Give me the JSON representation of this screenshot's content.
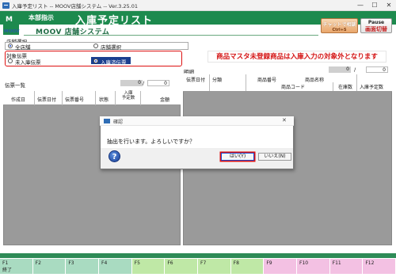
{
  "window": {
    "title": "入庫予定リスト -- MOOV店舗システム -- Ver.3.25.01",
    "minimize": "—",
    "maximize": "☐",
    "close": "✕"
  },
  "header": {
    "logo_letter": "M",
    "logo_text": "MOOV",
    "label": "本部指示",
    "title": "入庫予定リスト",
    "subtitle": "MOOV 店舗システム",
    "chat_button": {
      "line1": "チャットで相談",
      "line2": "Ctrl+S"
    },
    "pause_button": {
      "line1": "Pause",
      "line2": "画面切替"
    },
    "colors": {
      "brand_green": "#1d8a4e",
      "accent_red": "#d41414"
    }
  },
  "store_selection": {
    "label": "店舗選択",
    "options": [
      {
        "label": "全店舗",
        "selected": true
      },
      {
        "label": "店舗選択",
        "selected": false
      }
    ]
  },
  "slip_target": {
    "label": "対象伝票",
    "options": [
      {
        "label": "未入庫伝票",
        "selected": false
      },
      {
        "label": "入庫済伝票",
        "selected": true
      }
    ]
  },
  "warning": "商品マスタ未登録商品は入庫入力の対象外となります",
  "detail": {
    "label": "明細",
    "count": "0",
    "slash": "/",
    "total": "0",
    "columns": [
      "伝票日付",
      "分類",
      "商品番号",
      "商品名称",
      "商品コード",
      "在庫数",
      "入庫予定数"
    ]
  },
  "slip_list": {
    "label": "伝票一覧",
    "count": "0",
    "slash": "/",
    "total": "0",
    "columns": [
      "作成日",
      "伝票日付",
      "伝票番号",
      "状態",
      "入庫\n予定数",
      "金額"
    ],
    "col_planned_line1": "入庫",
    "col_planned_line2": "予定数"
  },
  "dialog": {
    "title": "確認",
    "message": "抽出を行います。よろしいですか？",
    "icon": "question-icon",
    "icon_glyph": "?",
    "yes_button": "はい(Y)",
    "no_button": "いいえ(N)"
  },
  "function_keys": [
    {
      "key": "F1",
      "label": "終了",
      "color": "#a9dbc1"
    },
    {
      "key": "F2",
      "label": "",
      "color": "#a9dbc1"
    },
    {
      "key": "F3",
      "label": "",
      "color": "#a9dbc1"
    },
    {
      "key": "F4",
      "label": "",
      "color": "#a9dbc1"
    },
    {
      "key": "F5",
      "label": "",
      "color": "#bfe8a6"
    },
    {
      "key": "F6",
      "label": "",
      "color": "#bfe8a6"
    },
    {
      "key": "F7",
      "label": "",
      "color": "#bfe8a6"
    },
    {
      "key": "F8",
      "label": "",
      "color": "#bfe8a6"
    },
    {
      "key": "F9",
      "label": "",
      "color": "#f3c1e3"
    },
    {
      "key": "F10",
      "label": "",
      "color": "#f3c1e3"
    },
    {
      "key": "F11",
      "label": "",
      "color": "#f3c1e3"
    },
    {
      "key": "F12",
      "label": "",
      "color": "#f3c1e3"
    }
  ]
}
